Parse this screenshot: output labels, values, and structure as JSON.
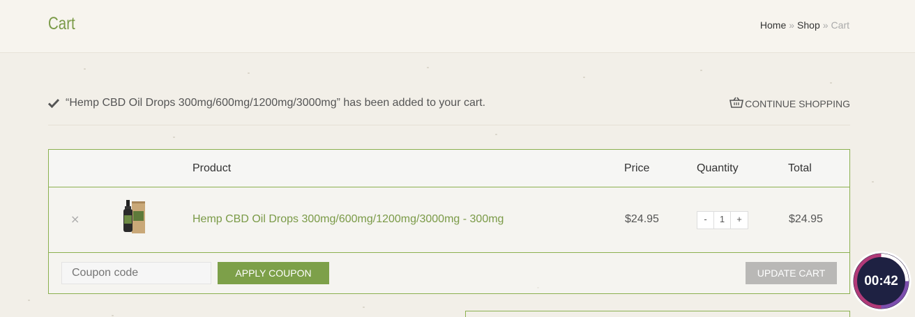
{
  "header": {
    "page_title": "Cart",
    "breadcrumb": {
      "home": "Home",
      "sep1": "»",
      "shop": "Shop",
      "sep2": "»",
      "current": "Cart"
    }
  },
  "notice": {
    "message": "“Hemp CBD Oil  Drops 300mg/600mg/1200mg/3000mg” has been added to your cart.",
    "continue_label": "CONTINUE SHOPPING"
  },
  "table": {
    "headers": {
      "product": "Product",
      "price": "Price",
      "quantity": "Quantity",
      "total": "Total"
    },
    "rows": [
      {
        "remove": "×",
        "product": "Hemp CBD Oil  Drops 300mg/600mg/1200mg/3000mg - 300mg",
        "price": "$24.95",
        "qty_minus": "-",
        "quantity": "1",
        "qty_plus": "+",
        "total": "$24.95"
      }
    ]
  },
  "actions": {
    "coupon_placeholder": "Coupon code",
    "apply_label": "APPLY COUPON",
    "update_label": "UPDATE CART"
  },
  "timer": {
    "label": "00:42"
  },
  "colors": {
    "accent": "#7da049",
    "border": "#8bb04f",
    "background": "#f2efe8"
  },
  "icons": [
    "check-icon",
    "basket-icon",
    "close-icon"
  ]
}
